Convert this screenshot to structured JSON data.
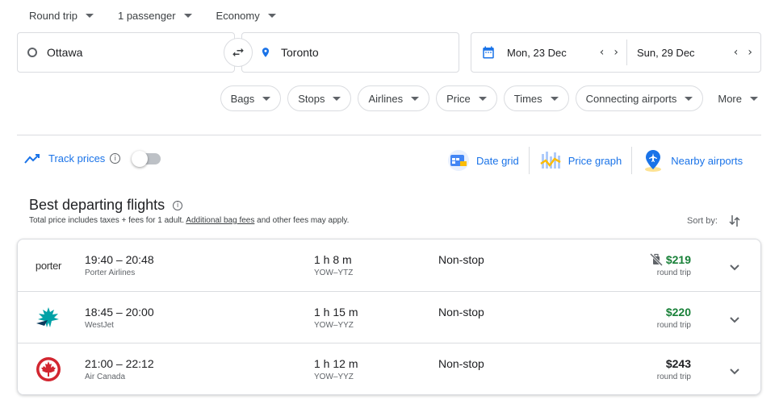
{
  "search": {
    "trip_type": "Round trip",
    "passengers": "1 passenger",
    "cabin": "Economy",
    "origin": "Ottawa",
    "destination": "Toronto",
    "depart_date": "Mon, 23 Dec",
    "return_date": "Sun, 29 Dec"
  },
  "filters": [
    "Bags",
    "Stops",
    "Airlines",
    "Price",
    "Times",
    "Connecting airports",
    "More"
  ],
  "tools": {
    "track_prices": "Track prices",
    "date_grid": "Date grid",
    "price_graph": "Price graph",
    "nearby_airports": "Nearby airports"
  },
  "results_header": {
    "title": "Best departing flights",
    "subtext_before": "Total price includes taxes + fees for 1 adult. ",
    "subtext_link": "Additional bag fees",
    "subtext_after": " and other fees may apply.",
    "sort_by": "Sort by:"
  },
  "flights": [
    {
      "logo_text": "porter",
      "times": "19:40 – 20:48",
      "airline": "Porter Airlines",
      "duration": "1 h 8 m",
      "route": "YOW–YTZ",
      "stops": "Non-stop",
      "price": "$219",
      "price_sub": "round trip",
      "price_color": "#188038",
      "no_carry_on": true
    },
    {
      "logo_text": "",
      "times": "18:45 – 20:00",
      "airline": "WestJet",
      "duration": "1 h 15 m",
      "route": "YOW–YYZ",
      "stops": "Non-stop",
      "price": "$220",
      "price_sub": "round trip",
      "price_color": "#188038",
      "no_carry_on": false
    },
    {
      "logo_text": "",
      "times": "21:00 – 22:12",
      "airline": "Air Canada",
      "duration": "1 h 12 m",
      "route": "YOW–YYZ",
      "stops": "Non-stop",
      "price": "$243",
      "price_sub": "round trip",
      "price_color": "#202124",
      "no_carry_on": false
    }
  ],
  "colors": {
    "accent": "#1a73e8",
    "price_green": "#188038",
    "air_canada_red": "#d22630",
    "westjet_teal": "#00a1a6"
  }
}
